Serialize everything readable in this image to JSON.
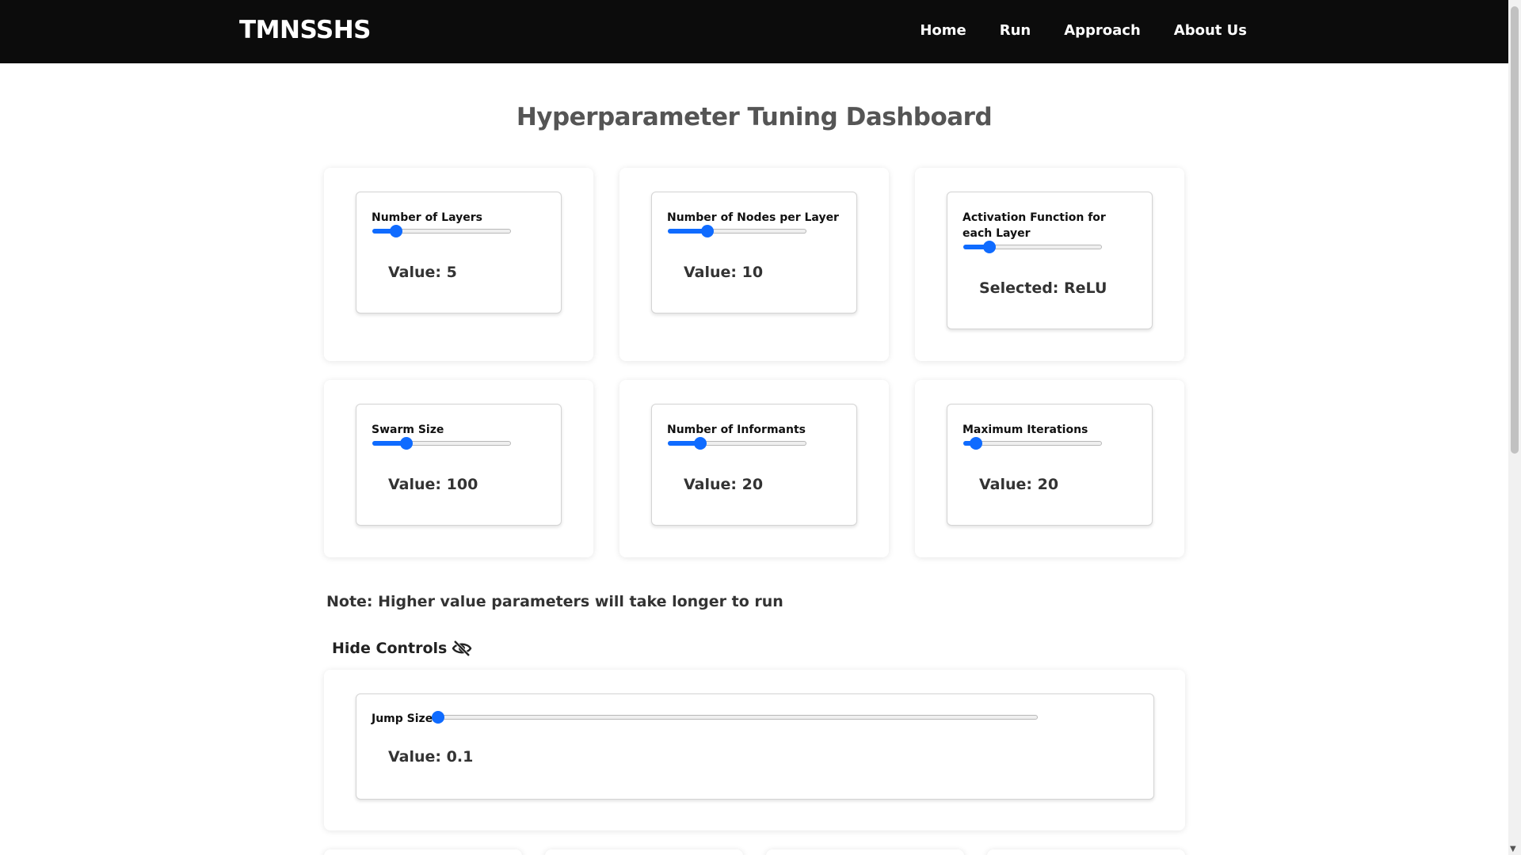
{
  "nav": {
    "brand": "TMNSSHS",
    "links": [
      "Home",
      "Run",
      "Approach",
      "About Us"
    ]
  },
  "page": {
    "title": "Hyperparameter Tuning Dashboard",
    "note": "Note: Higher value parameters will take longer to run",
    "toggle_label": "Hide Controls"
  },
  "controls": [
    {
      "label": "Number of Layers",
      "value_text": "Value: 5",
      "slider_fraction": 0.14
    },
    {
      "label": "Number of Nodes per Layer",
      "value_text": "Value: 10",
      "slider_fraction": 0.27
    },
    {
      "label": "Activation Function for each Layer",
      "value_text": "Selected: ReLU",
      "slider_fraction": 0.16
    },
    {
      "label": "Swarm Size",
      "value_text": "Value: 100",
      "slider_fraction": 0.22
    },
    {
      "label": "Number of Informants",
      "value_text": "Value: 20",
      "slider_fraction": 0.21
    },
    {
      "label": "Maximum Iterations",
      "value_text": "Value: 20",
      "slider_fraction": 0.05
    }
  ],
  "jump": {
    "label": "Jump Size",
    "value_text": "Value: 0.1",
    "slider_fraction": 0.0
  },
  "colors": {
    "navbar": "#0c0c0c",
    "accent": "#0f6bff"
  },
  "icons": {
    "toggle": "eye-slash-icon"
  }
}
